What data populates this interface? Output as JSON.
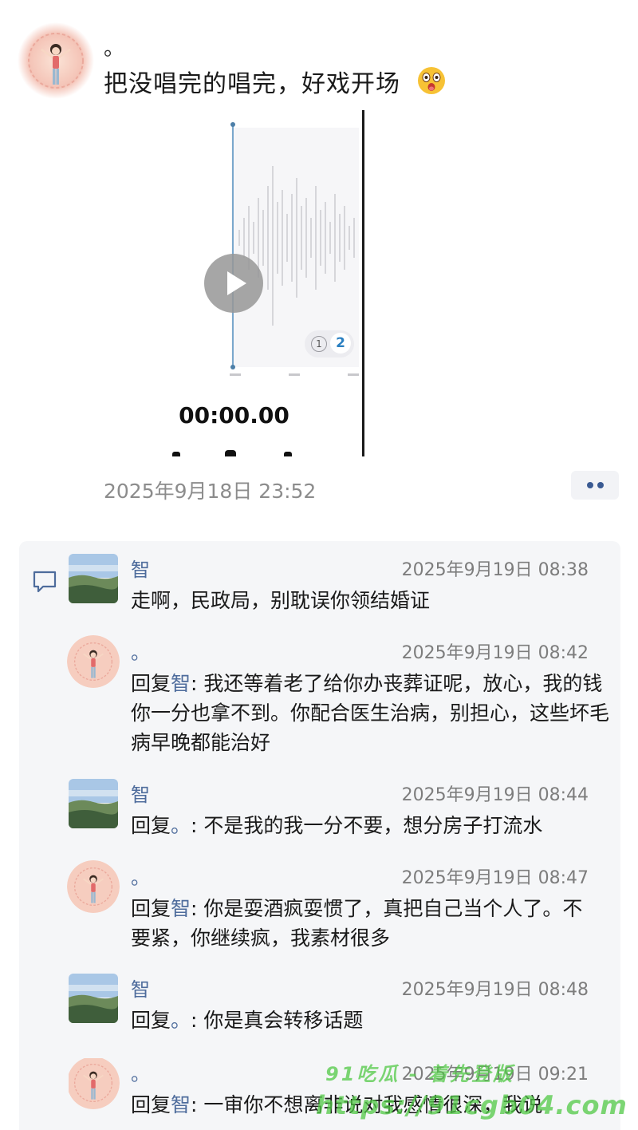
{
  "post": {
    "author": "。",
    "text": "把没唱完的唱完，好戏开场",
    "emoji": "astonished-face-emoji",
    "media": {
      "timer": "00:00.00",
      "page_indicator": [
        "1",
        "2"
      ],
      "play_icon": "play-icon"
    },
    "timestamp": "2025年9月18日 23:52",
    "more_icon": "more-dots-icon"
  },
  "comments": [
    {
      "name": "智",
      "avatar": "landscape",
      "time": "2025年9月19日 08:38",
      "reply_prefix": "",
      "reply_to": "",
      "text": "走啊，民政局，别耽误你领结婚证"
    },
    {
      "name": "。",
      "avatar": "girl",
      "time": "2025年9月19日 08:42",
      "reply_prefix": "回复",
      "reply_to": "智",
      "text": ": 我还等着老了给你办丧葬证呢，放心，我的钱你一分也拿不到。你配合医生治病，别担心，这些坏毛病早晚都能治好"
    },
    {
      "name": "智",
      "avatar": "landscape",
      "time": "2025年9月19日 08:44",
      "reply_prefix": "回复",
      "reply_to": "。",
      "text": ": 不是我的我一分不要，想分房子打流水"
    },
    {
      "name": "。",
      "avatar": "girl",
      "time": "2025年9月19日 08:47",
      "reply_prefix": "回复",
      "reply_to": "智",
      "text": ": 你是耍酒疯耍惯了，真把自己当个人了。不要紧，你继续疯，我素材很多"
    },
    {
      "name": "智",
      "avatar": "landscape",
      "time": "2025年9月19日 08:48",
      "reply_prefix": "回复",
      "reply_to": "。",
      "text": ": 你是真会转移话题"
    },
    {
      "name": "。",
      "avatar": "girl",
      "time": "2025年9月19日 09:21",
      "reply_prefix": "回复",
      "reply_to": "智",
      "text": ": 一审你不想离非说对我感情很深，我说"
    }
  ],
  "watermark": {
    "line1": "91吃瓜 - 着先登版",
    "line2": "https://91cgb04.com"
  },
  "colors": {
    "name_blue": "#4e6c9c",
    "timestamp_gray": "#8c8c8c",
    "panel_bg": "#f5f6f8",
    "watermark_green": "#50c846"
  }
}
